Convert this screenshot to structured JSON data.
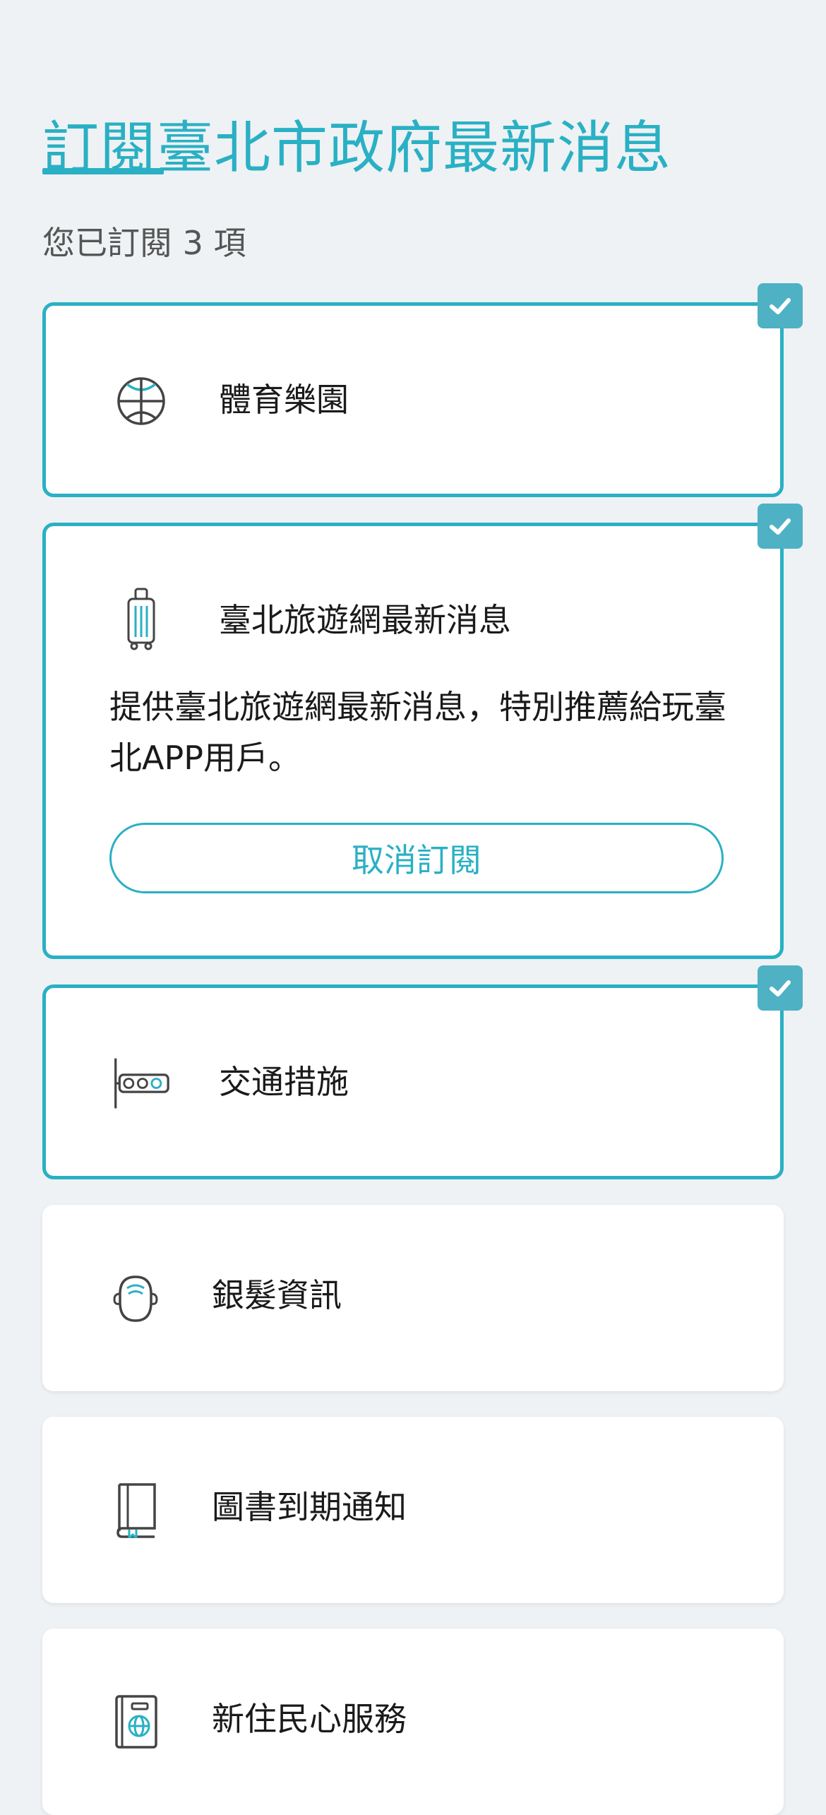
{
  "header": {
    "title": "訂閱臺北市政府最新消息",
    "subscribed_count_text": "您已訂閱 3 項"
  },
  "colors": {
    "accent": "#2ab0c4",
    "badge": "#4fb1c4",
    "background": "#eef2f4",
    "card": "#ffffff"
  },
  "subscriptions": [
    {
      "label": "體育樂園",
      "icon": "basketball-icon",
      "subscribed": true
    },
    {
      "label": "臺北旅遊網最新消息",
      "icon": "suitcase-icon",
      "subscribed": true,
      "expanded": true,
      "description": "提供臺北旅遊網最新消息，特別推薦給玩臺北APP用戶。",
      "unsubscribe_label": "取消訂閱"
    },
    {
      "label": "交通措施",
      "icon": "traffic-light-icon",
      "subscribed": true
    },
    {
      "label": "銀髮資訊",
      "icon": "elderly-person-icon",
      "subscribed": false
    },
    {
      "label": "圖書到期通知",
      "icon": "book-icon",
      "subscribed": false
    },
    {
      "label": "新住民心服務",
      "icon": "passport-icon",
      "subscribed": false
    }
  ]
}
